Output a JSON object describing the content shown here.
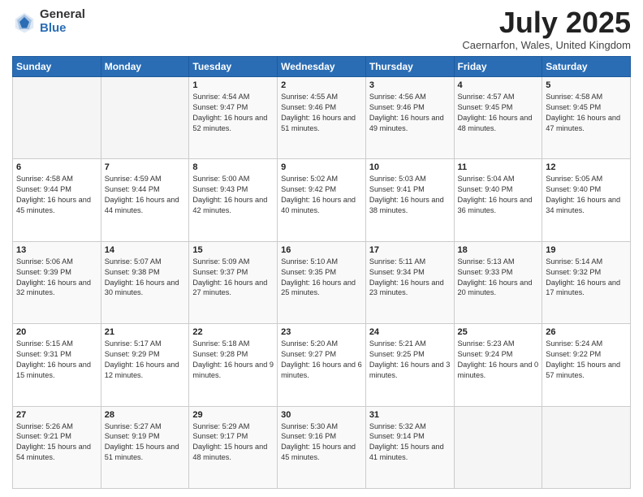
{
  "header": {
    "logo_general": "General",
    "logo_blue": "Blue",
    "month_title": "July 2025",
    "location": "Caernarfon, Wales, United Kingdom"
  },
  "weekdays": [
    "Sunday",
    "Monday",
    "Tuesday",
    "Wednesday",
    "Thursday",
    "Friday",
    "Saturday"
  ],
  "weeks": [
    [
      {
        "day": "",
        "sunrise": "",
        "sunset": "",
        "daylight": ""
      },
      {
        "day": "",
        "sunrise": "",
        "sunset": "",
        "daylight": ""
      },
      {
        "day": "1",
        "sunrise": "Sunrise: 4:54 AM",
        "sunset": "Sunset: 9:47 PM",
        "daylight": "Daylight: 16 hours and 52 minutes."
      },
      {
        "day": "2",
        "sunrise": "Sunrise: 4:55 AM",
        "sunset": "Sunset: 9:46 PM",
        "daylight": "Daylight: 16 hours and 51 minutes."
      },
      {
        "day": "3",
        "sunrise": "Sunrise: 4:56 AM",
        "sunset": "Sunset: 9:46 PM",
        "daylight": "Daylight: 16 hours and 49 minutes."
      },
      {
        "day": "4",
        "sunrise": "Sunrise: 4:57 AM",
        "sunset": "Sunset: 9:45 PM",
        "daylight": "Daylight: 16 hours and 48 minutes."
      },
      {
        "day": "5",
        "sunrise": "Sunrise: 4:58 AM",
        "sunset": "Sunset: 9:45 PM",
        "daylight": "Daylight: 16 hours and 47 minutes."
      }
    ],
    [
      {
        "day": "6",
        "sunrise": "Sunrise: 4:58 AM",
        "sunset": "Sunset: 9:44 PM",
        "daylight": "Daylight: 16 hours and 45 minutes."
      },
      {
        "day": "7",
        "sunrise": "Sunrise: 4:59 AM",
        "sunset": "Sunset: 9:44 PM",
        "daylight": "Daylight: 16 hours and 44 minutes."
      },
      {
        "day": "8",
        "sunrise": "Sunrise: 5:00 AM",
        "sunset": "Sunset: 9:43 PM",
        "daylight": "Daylight: 16 hours and 42 minutes."
      },
      {
        "day": "9",
        "sunrise": "Sunrise: 5:02 AM",
        "sunset": "Sunset: 9:42 PM",
        "daylight": "Daylight: 16 hours and 40 minutes."
      },
      {
        "day": "10",
        "sunrise": "Sunrise: 5:03 AM",
        "sunset": "Sunset: 9:41 PM",
        "daylight": "Daylight: 16 hours and 38 minutes."
      },
      {
        "day": "11",
        "sunrise": "Sunrise: 5:04 AM",
        "sunset": "Sunset: 9:40 PM",
        "daylight": "Daylight: 16 hours and 36 minutes."
      },
      {
        "day": "12",
        "sunrise": "Sunrise: 5:05 AM",
        "sunset": "Sunset: 9:40 PM",
        "daylight": "Daylight: 16 hours and 34 minutes."
      }
    ],
    [
      {
        "day": "13",
        "sunrise": "Sunrise: 5:06 AM",
        "sunset": "Sunset: 9:39 PM",
        "daylight": "Daylight: 16 hours and 32 minutes."
      },
      {
        "day": "14",
        "sunrise": "Sunrise: 5:07 AM",
        "sunset": "Sunset: 9:38 PM",
        "daylight": "Daylight: 16 hours and 30 minutes."
      },
      {
        "day": "15",
        "sunrise": "Sunrise: 5:09 AM",
        "sunset": "Sunset: 9:37 PM",
        "daylight": "Daylight: 16 hours and 27 minutes."
      },
      {
        "day": "16",
        "sunrise": "Sunrise: 5:10 AM",
        "sunset": "Sunset: 9:35 PM",
        "daylight": "Daylight: 16 hours and 25 minutes."
      },
      {
        "day": "17",
        "sunrise": "Sunrise: 5:11 AM",
        "sunset": "Sunset: 9:34 PM",
        "daylight": "Daylight: 16 hours and 23 minutes."
      },
      {
        "day": "18",
        "sunrise": "Sunrise: 5:13 AM",
        "sunset": "Sunset: 9:33 PM",
        "daylight": "Daylight: 16 hours and 20 minutes."
      },
      {
        "day": "19",
        "sunrise": "Sunrise: 5:14 AM",
        "sunset": "Sunset: 9:32 PM",
        "daylight": "Daylight: 16 hours and 17 minutes."
      }
    ],
    [
      {
        "day": "20",
        "sunrise": "Sunrise: 5:15 AM",
        "sunset": "Sunset: 9:31 PM",
        "daylight": "Daylight: 16 hours and 15 minutes."
      },
      {
        "day": "21",
        "sunrise": "Sunrise: 5:17 AM",
        "sunset": "Sunset: 9:29 PM",
        "daylight": "Daylight: 16 hours and 12 minutes."
      },
      {
        "day": "22",
        "sunrise": "Sunrise: 5:18 AM",
        "sunset": "Sunset: 9:28 PM",
        "daylight": "Daylight: 16 hours and 9 minutes."
      },
      {
        "day": "23",
        "sunrise": "Sunrise: 5:20 AM",
        "sunset": "Sunset: 9:27 PM",
        "daylight": "Daylight: 16 hours and 6 minutes."
      },
      {
        "day": "24",
        "sunrise": "Sunrise: 5:21 AM",
        "sunset": "Sunset: 9:25 PM",
        "daylight": "Daylight: 16 hours and 3 minutes."
      },
      {
        "day": "25",
        "sunrise": "Sunrise: 5:23 AM",
        "sunset": "Sunset: 9:24 PM",
        "daylight": "Daylight: 16 hours and 0 minutes."
      },
      {
        "day": "26",
        "sunrise": "Sunrise: 5:24 AM",
        "sunset": "Sunset: 9:22 PM",
        "daylight": "Daylight: 15 hours and 57 minutes."
      }
    ],
    [
      {
        "day": "27",
        "sunrise": "Sunrise: 5:26 AM",
        "sunset": "Sunset: 9:21 PM",
        "daylight": "Daylight: 15 hours and 54 minutes."
      },
      {
        "day": "28",
        "sunrise": "Sunrise: 5:27 AM",
        "sunset": "Sunset: 9:19 PM",
        "daylight": "Daylight: 15 hours and 51 minutes."
      },
      {
        "day": "29",
        "sunrise": "Sunrise: 5:29 AM",
        "sunset": "Sunset: 9:17 PM",
        "daylight": "Daylight: 15 hours and 48 minutes."
      },
      {
        "day": "30",
        "sunrise": "Sunrise: 5:30 AM",
        "sunset": "Sunset: 9:16 PM",
        "daylight": "Daylight: 15 hours and 45 minutes."
      },
      {
        "day": "31",
        "sunrise": "Sunrise: 5:32 AM",
        "sunset": "Sunset: 9:14 PM",
        "daylight": "Daylight: 15 hours and 41 minutes."
      },
      {
        "day": "",
        "sunrise": "",
        "sunset": "",
        "daylight": ""
      },
      {
        "day": "",
        "sunrise": "",
        "sunset": "",
        "daylight": ""
      }
    ]
  ]
}
